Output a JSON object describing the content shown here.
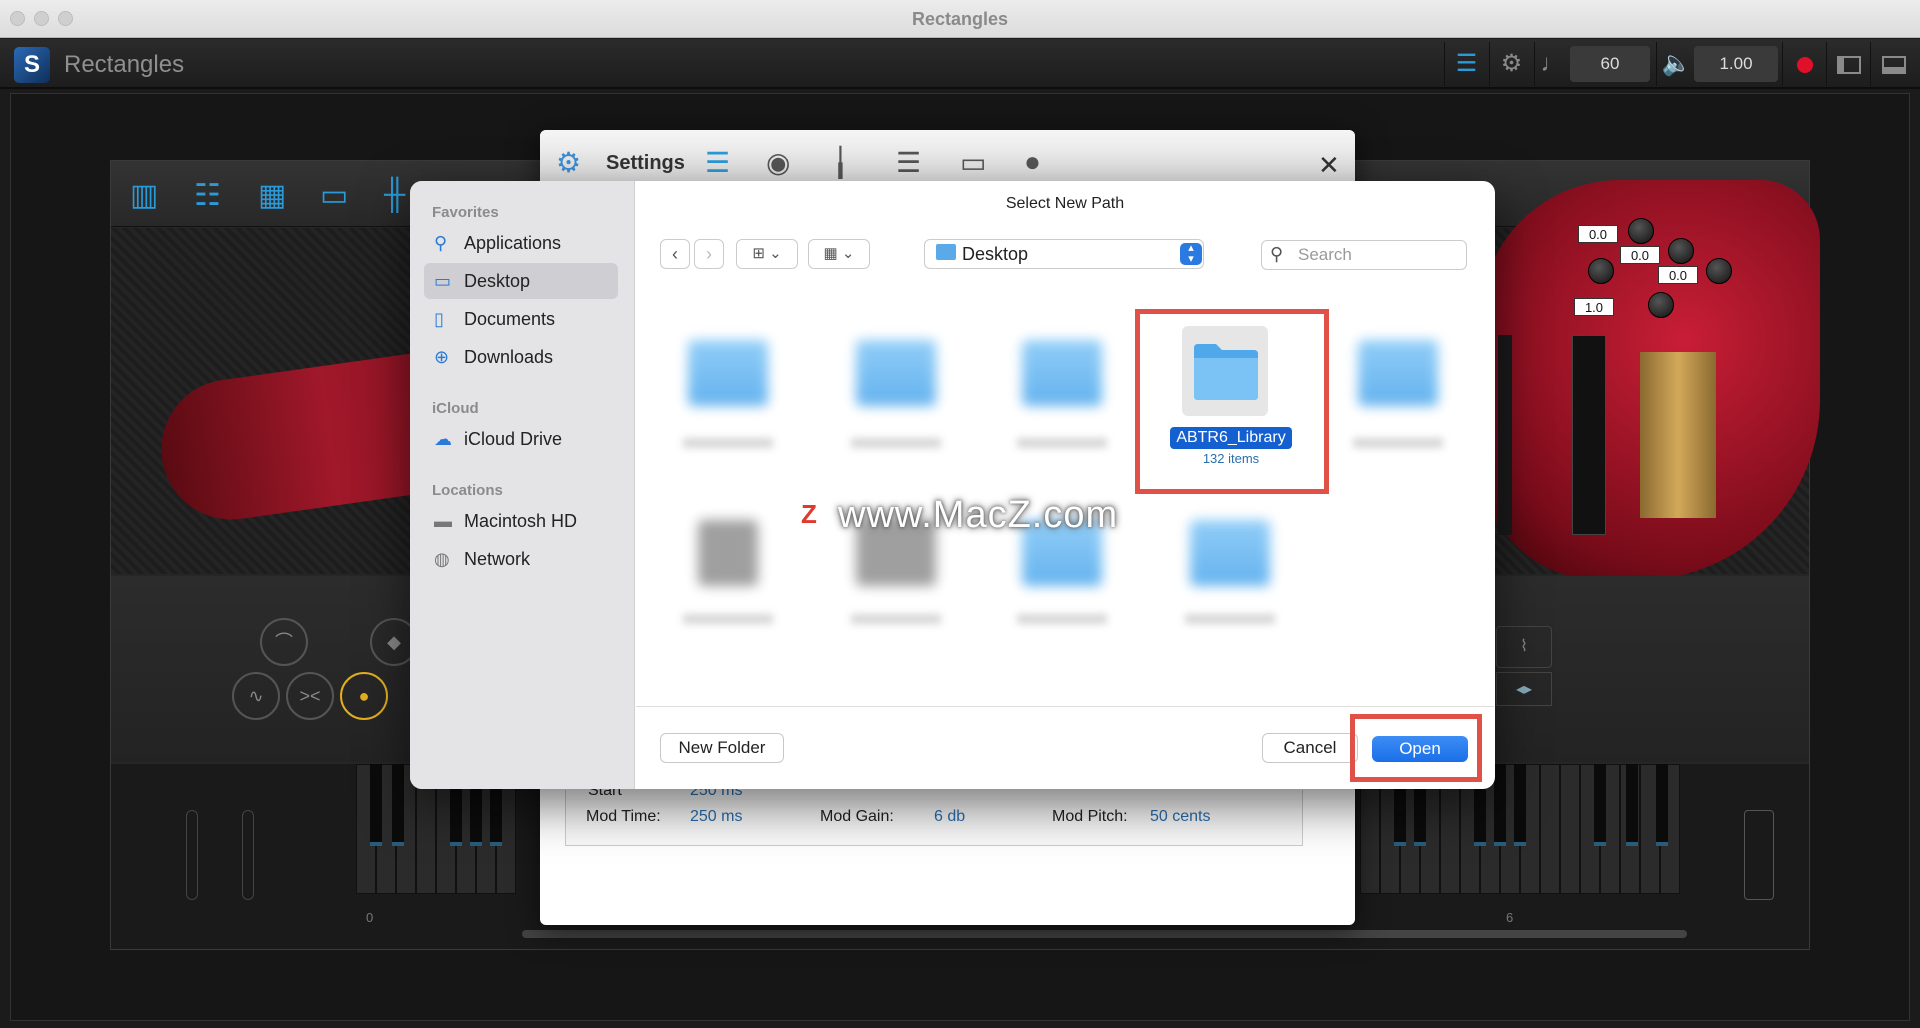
{
  "window": {
    "title": "Rectangles"
  },
  "app": {
    "name": "Rectangles",
    "tempo": "60",
    "volume": "1.00"
  },
  "instrument": {
    "readouts": [
      "0.0",
      "0.0",
      "0.0",
      "1.0"
    ],
    "key_labels": [
      "0",
      "6"
    ]
  },
  "settings": {
    "title": "Settings",
    "start_label": "Start",
    "start_value": "250 ms",
    "mod_time_label": "Mod Time:",
    "mod_time_value": "250 ms",
    "mod_gain_label": "Mod Gain:",
    "mod_gain_value": "6 db",
    "mod_pitch_label": "Mod Pitch:",
    "mod_pitch_value": "50 cents"
  },
  "file_dialog": {
    "title": "Select New Path",
    "favorites_header": "Favorites",
    "favorites": [
      "Applications",
      "Desktop",
      "Documents",
      "Downloads"
    ],
    "selected_favorite": "Desktop",
    "icloud_header": "iCloud",
    "icloud_items": [
      "iCloud Drive"
    ],
    "locations_header": "Locations",
    "locations": [
      "Macintosh HD",
      "Network"
    ],
    "path": "Desktop",
    "search_placeholder": "Search",
    "selected_item": {
      "name": "ABTR6_Library",
      "count": "132 items"
    },
    "new_folder_label": "New Folder",
    "cancel_label": "Cancel",
    "open_label": "Open"
  },
  "watermark": "www.MacZ.com",
  "colors": {
    "accent": "#1a6fe8",
    "highlight_box": "#e05248",
    "instrument_red": "#a0182a"
  }
}
